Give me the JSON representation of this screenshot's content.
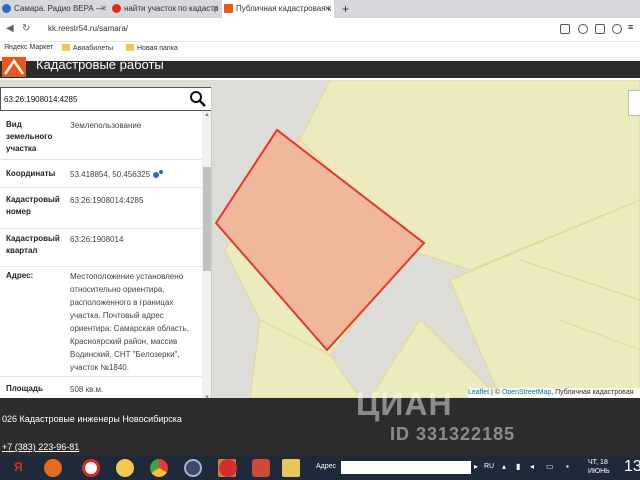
{
  "tabs": [
    {
      "label": "Самара. Радио ВЕРА —",
      "active": false
    },
    {
      "label": "найти участок по кадастр",
      "active": false
    },
    {
      "label": "Публичная кадастровая к",
      "active": true
    }
  ],
  "new_tab_label": "+",
  "address": {
    "url": "kk.reestr54.ru/samara/"
  },
  "bookmarks": [
    "Яндекс Маркет",
    "Авиабилеты",
    "Новая папка"
  ],
  "site": {
    "title": "Кадастровые работы"
  },
  "search": {
    "value": "63:26:1908014:4285"
  },
  "parcel": {
    "rows": [
      {
        "label": "Вид земельного участка",
        "value": "Землепользование"
      },
      {
        "label": "Координаты",
        "value": "53.418854, 50.456325"
      },
      {
        "label": "Кадастровый номер",
        "value": "63:26:1908014:4285"
      },
      {
        "label": "Кадастровый квартал",
        "value": "63:26:1908014"
      },
      {
        "label": "Адрес:",
        "value": "Местоположение установлено относительно ориентира, расположенного в границах участка. Почтовый адрес ориентира: Самарская область, Красноярский район, массив Водинский, СНТ \"Белозерки\", участок №1840."
      },
      {
        "label": "Площадь уточненная:",
        "value": "508 кв.м."
      }
    ]
  },
  "map": {
    "attribution": {
      "leaflet": "Leaflet",
      "sep": " | © ",
      "osm": "OpenStreetMap",
      "rest": ", Публичная кадастровая"
    },
    "colors": {
      "background": "#dedcd6",
      "parcel_fill": "#ecebbd",
      "parcel_border": "#e6d690",
      "selected_fill": "#f0b79a",
      "selected_border": "#e23a2a"
    }
  },
  "footer": {
    "company": "026 Кадастровые инженеры Новосибирска",
    "phone": "+7 (383) 223-96-81"
  },
  "watermark": {
    "logo": "ЦИАН",
    "id": "ID 331322185"
  },
  "taskbar": {
    "address_label": "Адрес",
    "lang": "RU",
    "day": "ЧТ, 18",
    "month": "ИЮНЬ",
    "clock": "13"
  }
}
